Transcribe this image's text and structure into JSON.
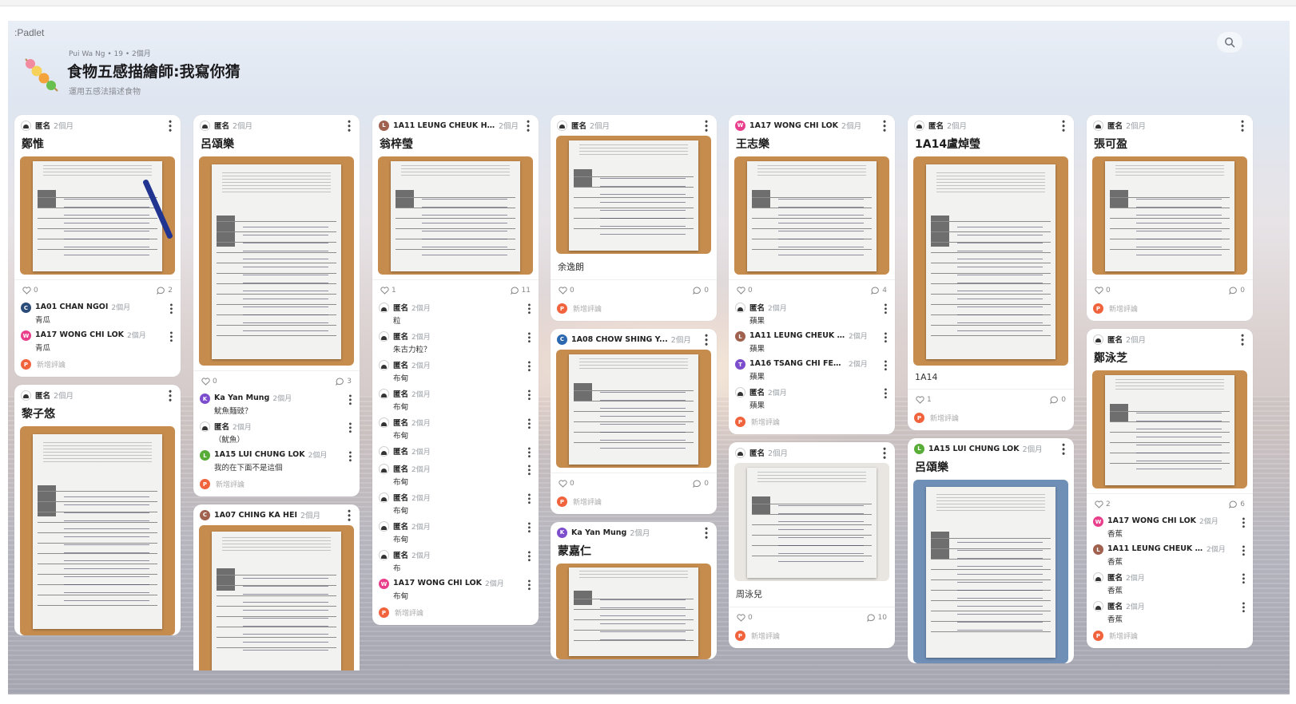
{
  "app": {
    "logo": ":Padlet"
  },
  "board": {
    "meta": "Pui Wa Ng  • 19  • 2個月",
    "title": "食物五感描繪師:我寫你猜",
    "subtitle": "運用五感法描述食物",
    "search_icon": "search-icon"
  },
  "ui": {
    "add_comment": "新增評論",
    "more_icon": "more-vertical-icon",
    "heart_icon": "heart-icon",
    "comment_icon": "comment-icon"
  },
  "colors": {
    "orange": "#f0633c",
    "pink": "#e83e8c",
    "brown": "#a0614f",
    "purple": "#7c4dcc",
    "blue": "#2c68b0",
    "green": "#58ac38",
    "dark_blue": "#2b4b79"
  },
  "columns": [
    {
      "cards": [
        {
          "author": "匿名",
          "time": "2個月",
          "title": "鄭惟",
          "likes": "0",
          "comments": "2",
          "comment_list": [
            {
              "author": "1A01 CHAN NGOI",
              "time": "2個月",
              "text": "青瓜"
            },
            {
              "author": "1A17 WONG CHI LOK",
              "time": "2個月",
              "text": "青瓜"
            }
          ]
        },
        {
          "author": "匿名",
          "time": "2個月",
          "title": "黎子悠"
        }
      ]
    },
    {
      "cards": [
        {
          "author": "匿名",
          "time": "2個月",
          "title": "呂頌樂",
          "likes": "0",
          "comments": "3",
          "comment_list": [
            {
              "author": "Ka Yan Mung",
              "time": "2個月",
              "text": "魷魚麵豉？"
            },
            {
              "author": "匿名",
              "time": "2個月",
              "text": "（魷魚）"
            },
            {
              "author": "1A15 LUI CHUNG LOK",
              "time": "2個月",
              "text": "我的在下面不是這個"
            }
          ]
        },
        {
          "author": "1A07 CHING KA HEI",
          "time": "2個月"
        }
      ]
    },
    {
      "cards": [
        {
          "author": "1A11 LEUNG CHEUK H...",
          "time": "2個月",
          "title": "翁梓瑩",
          "likes": "1",
          "comments": "11",
          "comment_list": [
            {
              "author": "匿名",
              "time": "2個月",
              "text": "粒"
            },
            {
              "author": "匿名",
              "time": "2個月",
              "text": "朱古力粒？"
            },
            {
              "author": "匿名",
              "time": "2個月",
              "text": "布甸"
            },
            {
              "author": "匿名",
              "time": "2個月",
              "text": "布甸"
            },
            {
              "author": "匿名",
              "time": "2個月",
              "text": "布甸"
            },
            {
              "author": "匿名",
              "time": "2個月",
              "text": ""
            },
            {
              "author": "匿名",
              "time": "2個月",
              "text": "布甸"
            },
            {
              "author": "匿名",
              "time": "2個月",
              "text": "布甸"
            },
            {
              "author": "匿名",
              "time": "2個月",
              "text": "布甸"
            },
            {
              "author": "匿名",
              "time": "2個月",
              "text": "布"
            },
            {
              "author": "1A17 WONG CHI LOK",
              "time": "2個月",
              "text": "布甸"
            }
          ]
        }
      ]
    },
    {
      "cards": [
        {
          "author": "匿名",
          "time": "2個月",
          "caption": "余逸朗",
          "likes": "0",
          "comments": "0"
        },
        {
          "author": "1A08 CHOW SHING Y...",
          "time": "2個月",
          "likes": "0",
          "comments": "0"
        },
        {
          "author": "Ka Yan Mung",
          "time": "2個月",
          "title": "蒙嘉仁"
        }
      ]
    },
    {
      "cards": [
        {
          "author": "1A17 WONG CHI LOK",
          "time": "2個月",
          "title": "王志樂",
          "likes": "0",
          "comments": "4",
          "comment_list": [
            {
              "author": "匿名",
              "time": "2個月",
              "text": "蘋果"
            },
            {
              "author": "1A11 LEUNG CHEUK HUNG",
              "time": "2個月",
              "text": "蘋果"
            },
            {
              "author": "1A16 TSANG CHI FENG",
              "time": "2個月",
              "text": "蘋果"
            },
            {
              "author": "匿名",
              "time": "2個月",
              "text": "蘋果"
            }
          ]
        },
        {
          "author": "匿名",
          "time": "2個月",
          "caption": "周泳兒",
          "likes": "0",
          "comments": "10"
        }
      ]
    },
    {
      "cards": [
        {
          "author": "匿名",
          "time": "2個月",
          "title": "1A14盧焯瑩",
          "caption": "1A14",
          "likes": "1",
          "comments": "0"
        },
        {
          "author": "1A15 LUI CHUNG LOK",
          "time": "2個月",
          "title": "呂頌樂"
        }
      ]
    },
    {
      "cards": [
        {
          "author": "匿名",
          "time": "2個月",
          "title": "張可盈",
          "likes": "0",
          "comments": "0"
        },
        {
          "author": "匿名",
          "time": "2個月",
          "title": "鄭泳芝",
          "likes": "2",
          "comments": "6",
          "comment_list": [
            {
              "author": "1A17 WONG CHI LOK",
              "time": "2個月",
              "text": "香蕉"
            },
            {
              "author": "1A11 LEUNG CHEUK HUNG",
              "time": "2個月",
              "text": "香蕉"
            },
            {
              "author": "匿名",
              "time": "2個月",
              "text": "香蕉"
            },
            {
              "author": "匿名",
              "time": "2個月",
              "text": "香蕉"
            }
          ]
        }
      ]
    }
  ]
}
